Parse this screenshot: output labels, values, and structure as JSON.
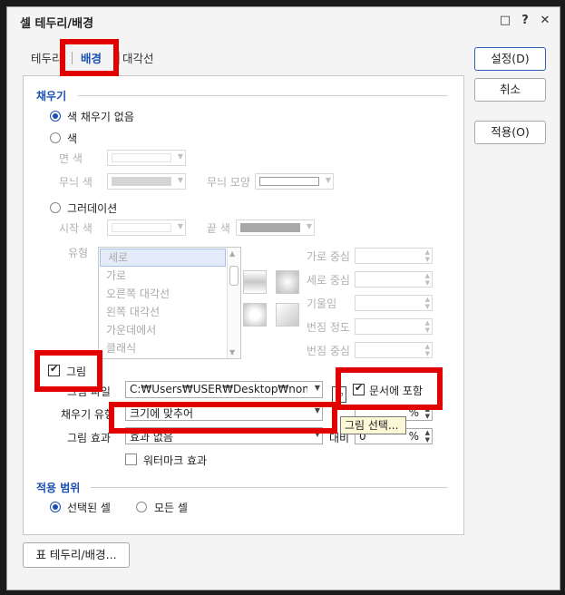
{
  "window": {
    "title": "셀 테두리/배경"
  },
  "tabs": [
    {
      "label": "테두리"
    },
    {
      "label": "배경"
    },
    {
      "label": "대각선"
    }
  ],
  "fill": {
    "section_title": "채우기",
    "no_fill_label": "색 채우기 없음",
    "color_label": "색",
    "face_color_label": "면 색",
    "pattern_color_label": "무늬 색",
    "pattern_shape_label": "무늬 모양",
    "gradation_label": "그러데이션",
    "start_color_label": "시작 색",
    "end_color_label": "끝 색",
    "type_label": "유형",
    "gradient_types": [
      "세로",
      "가로",
      "오른쪽 대각선",
      "왼쪽 대각선",
      "가운데에서",
      "클래식"
    ],
    "h_center_label": "가로 중심",
    "v_center_label": "세로 중심",
    "tilt_label": "기울임",
    "blur_degree_label": "번짐 정도",
    "blur_center_label": "번짐 중심"
  },
  "picture": {
    "checkbox_label": "그림",
    "file_label": "그림 파일",
    "file_path": "C:₩Users₩USER₩Desktop₩nonar",
    "include_doc_label": "문서에 포함",
    "fill_type_label": "채우기 유형",
    "fill_type_value": "크기에 맞추어",
    "tooltip": "그림 선택...",
    "effect_label": "그림 효과",
    "effect_value": "효과 없음",
    "contrast_label": "대비",
    "contrast_value": "0",
    "percent": "%",
    "watermark_label": "워터마크 효과"
  },
  "apply_range": {
    "section_title": "적용 범위",
    "selected_cells": "선택된 셀",
    "all_cells": "모든 셀"
  },
  "buttons": {
    "ok": "설정(D)",
    "cancel": "취소",
    "apply": "적용(O)",
    "table_border": "표 테두리/배경..."
  },
  "colors": {
    "accent": "#1a4fb4",
    "highlight_box": "#e20000"
  }
}
